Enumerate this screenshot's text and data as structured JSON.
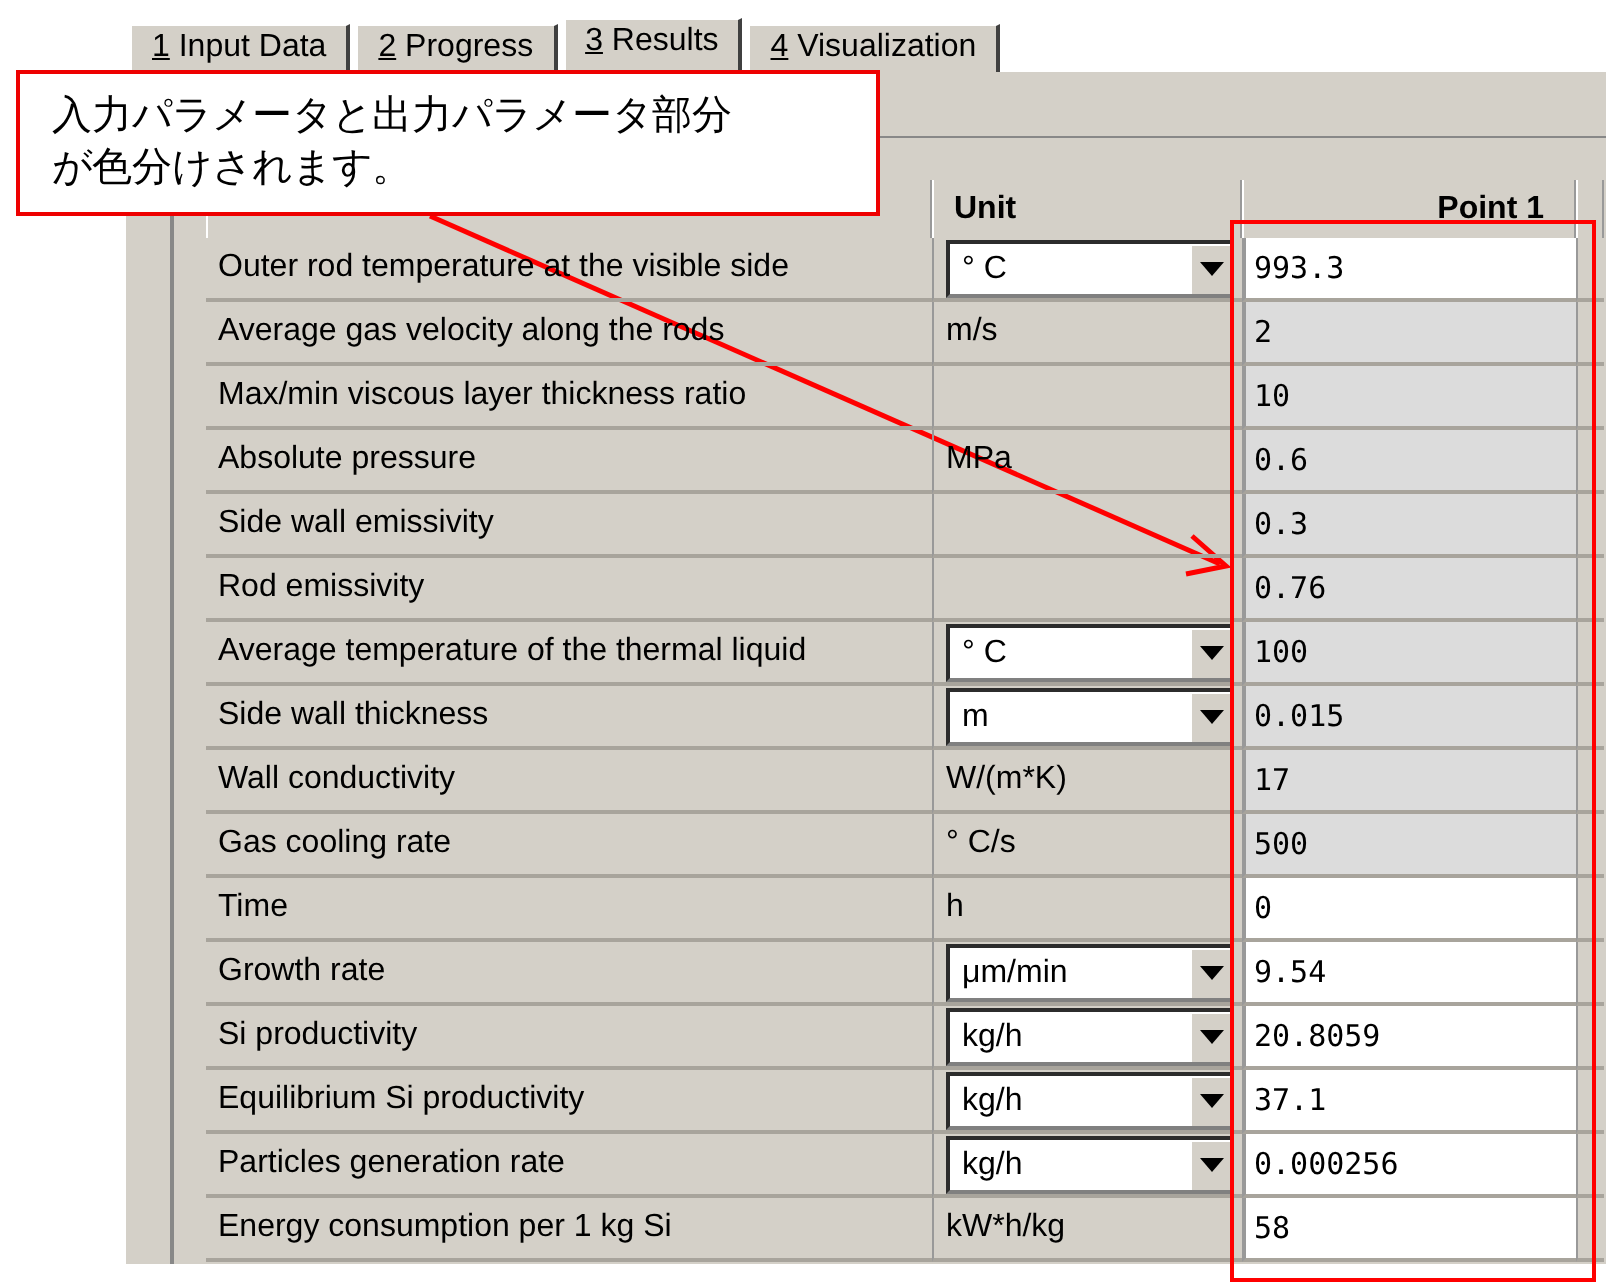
{
  "tabs": [
    {
      "key": "1",
      "label": "Input Data",
      "selected": false
    },
    {
      "key": "2",
      "label": "Progress",
      "selected": false
    },
    {
      "key": "3",
      "label": "Results",
      "selected": true
    },
    {
      "key": "4",
      "label": "Visualization",
      "selected": false
    }
  ],
  "table": {
    "columns": [
      "Unit",
      "Point 1"
    ],
    "rows": [
      {
        "name": "Outer rod temperature at the visible side",
        "unit": "° C",
        "kind": "dropdown",
        "value": "993.3",
        "editable": true
      },
      {
        "name": "Average gas velocity along the rods",
        "unit": "m/s",
        "kind": "text",
        "value": "2",
        "editable": false
      },
      {
        "name": "Max/min viscous layer thickness ratio",
        "kind": "text",
        "value": "10",
        "editable": false
      },
      {
        "name": "Absolute pressure",
        "unit": "MPa",
        "kind": "text",
        "value": "0.6",
        "editable": false
      },
      {
        "name": "Side wall emissivity",
        "kind": "text",
        "value": "0.3",
        "editable": false
      },
      {
        "name": "Rod emissivity",
        "kind": "text",
        "value": "0.76",
        "editable": false
      },
      {
        "name": "Average temperature of the thermal liquid",
        "unit": "° C",
        "kind": "dropdown",
        "value": "100",
        "editable": false
      },
      {
        "name": "Side wall thickness",
        "unit": "m",
        "kind": "dropdown",
        "value": "0.015",
        "editable": false
      },
      {
        "name": "Wall conductivity",
        "unit": "W/(m*K)",
        "kind": "text",
        "value": "17",
        "editable": false
      },
      {
        "name": "Gas cooling rate",
        "unit": "° C/s",
        "kind": "text",
        "value": "500",
        "editable": false
      },
      {
        "name": "Time",
        "unit": "h",
        "kind": "text",
        "value": "0",
        "editable": true
      },
      {
        "name": "Growth rate",
        "unit": "μm/min",
        "kind": "dropdown",
        "value": "9.54",
        "editable": true
      },
      {
        "name": "Si productivity",
        "unit": "kg/h",
        "kind": "dropdown",
        "value": "20.8059",
        "editable": true
      },
      {
        "name": "Equilibrium Si productivity",
        "unit": "kg/h",
        "kind": "dropdown",
        "value": "37.1",
        "editable": true
      },
      {
        "name": "Particles generation rate",
        "unit": "kg/h",
        "kind": "dropdown",
        "value": "0.000256",
        "editable": true
      },
      {
        "name": "Energy consumption per 1 kg Si",
        "unit": "kW*h/kg",
        "kind": "text",
        "value": "58",
        "editable": true
      }
    ]
  },
  "callout": {
    "lines": [
      "入力パラメータと出力パラメータ部分",
      "が色分けされます。"
    ]
  }
}
